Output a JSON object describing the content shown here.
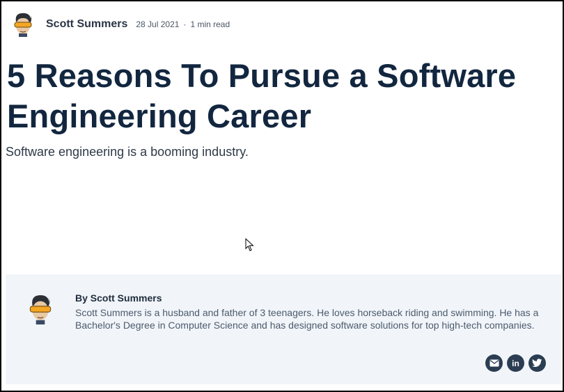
{
  "post": {
    "author_name": "Scott Summers",
    "date": "28 Jul 2021",
    "separator": "·",
    "read_time": "1 min read",
    "title": "5 Reasons To Pursue a Software Engineering Career",
    "subtitle": "Software engineering is a booming industry."
  },
  "bio": {
    "byline": "By Scott Summers",
    "text": "Scott Summers is a husband and father of 3 teenagers. He loves horseback riding and swimming. He has a Bachelor's Degree in Computer Science and has designed software solutions for top high-tech companies."
  },
  "social": {
    "icons": [
      "email-icon",
      "linkedin-icon",
      "twitter-icon"
    ],
    "linkedin_glyph": "in"
  },
  "colors": {
    "title": "#12263f",
    "card_bg": "#f1f5fa",
    "social_bg": "#2b3d52",
    "visor": "#f5a623"
  }
}
